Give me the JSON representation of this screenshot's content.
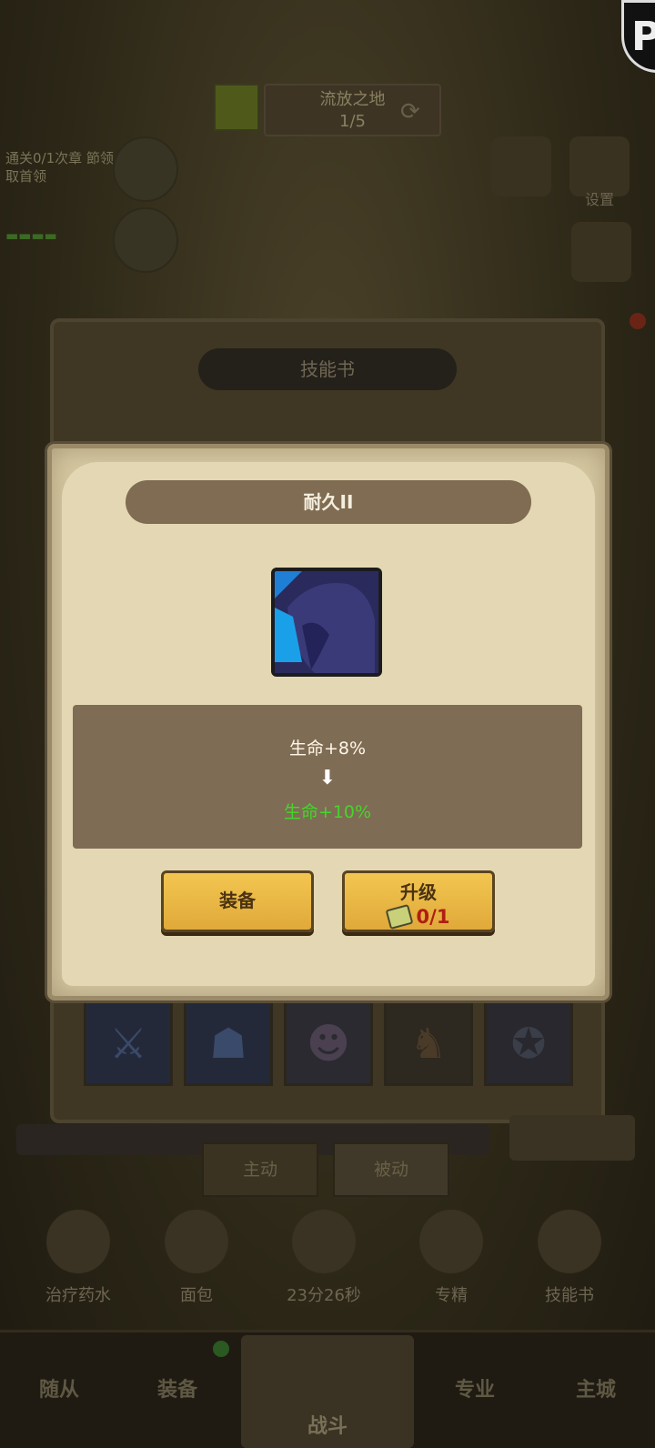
{
  "background": {
    "stage": {
      "name": "流放之地",
      "progress": "1/5"
    },
    "quest": {
      "text": "通关0/1次章 節领取首领"
    },
    "side_labels": [
      "设置"
    ],
    "panel_title": "技能书",
    "tabs": [
      "主动",
      "被动"
    ],
    "shop_labels": [
      "治疗药水",
      "面包",
      "23分26秒",
      "专精",
      "技能书"
    ],
    "nav": [
      "随从",
      "装备",
      "战斗",
      "专业",
      "主城"
    ]
  },
  "dialog": {
    "title": "耐久II",
    "current_effect": "生命+8%",
    "arrow": "⬇",
    "next_effect": "生命+10%",
    "equip_label": "装备",
    "upgrade_label": "升级",
    "upgrade_cost": "0/1"
  },
  "colors": {
    "next_effect": "#43d62a",
    "cost": "#b01e12",
    "button": "#f2c650"
  }
}
